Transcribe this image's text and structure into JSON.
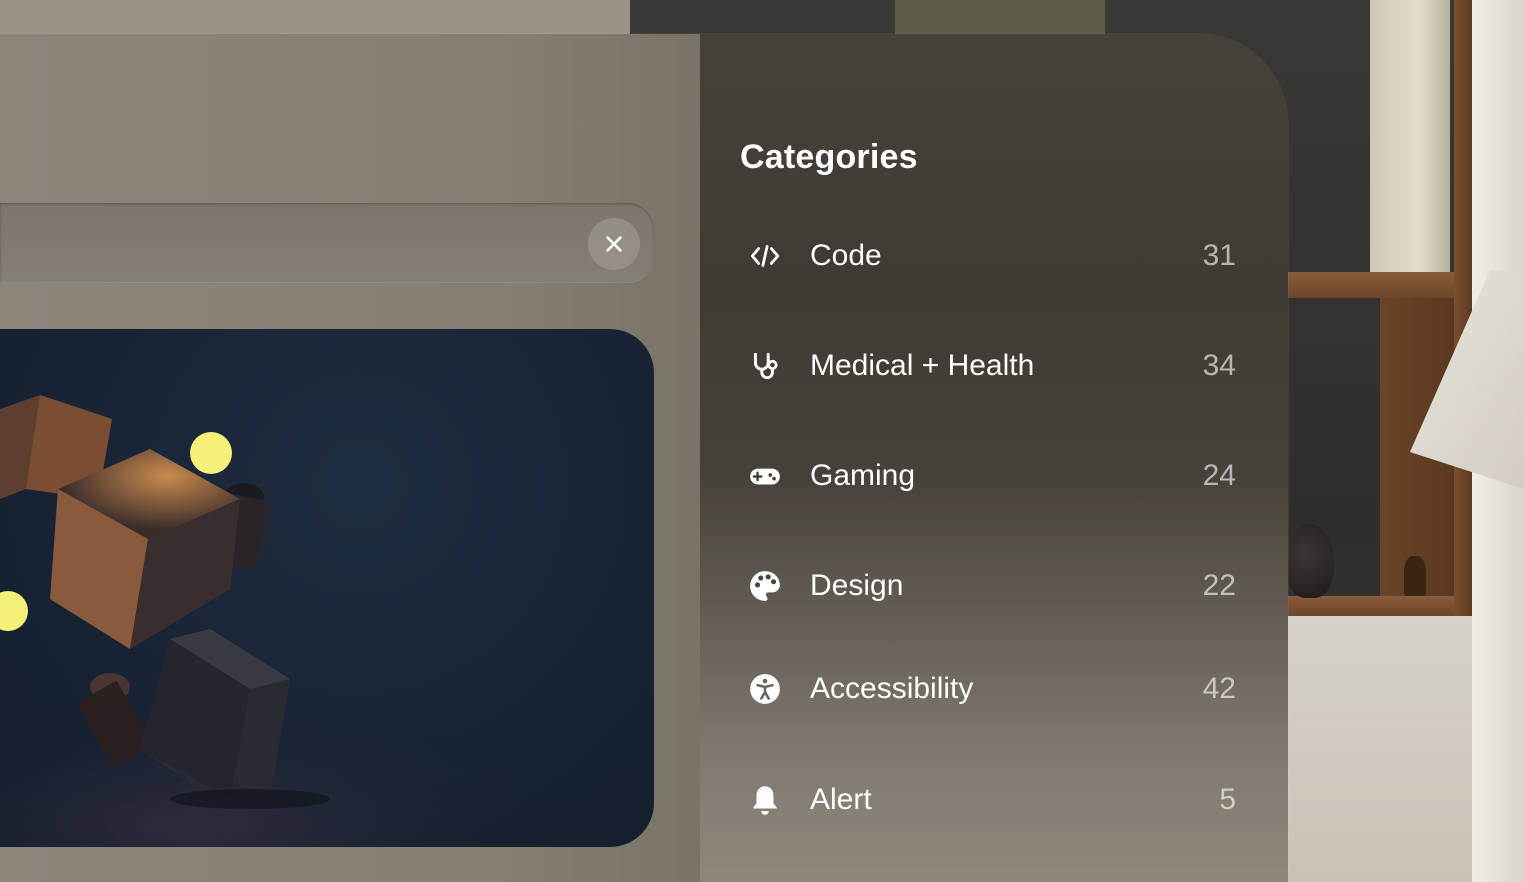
{
  "sidebar": {
    "title": "Categories",
    "items": [
      {
        "icon": "code-icon",
        "label": "Code",
        "count": "31"
      },
      {
        "icon": "stethoscope-icon",
        "label": "Medical + Health",
        "count": "34"
      },
      {
        "icon": "gamepad-icon",
        "label": "Gaming",
        "count": "24"
      },
      {
        "icon": "palette-icon",
        "label": "Design",
        "count": "22"
      },
      {
        "icon": "accessibility-icon",
        "label": "Accessibility",
        "count": "42"
      },
      {
        "icon": "bell-icon",
        "label": "Alert",
        "count": "5"
      }
    ]
  },
  "search": {
    "clear_icon": "close-icon"
  },
  "colors": {
    "text": "#ffffff",
    "count_text": "#c6c2bb",
    "sphere": "#f4f07a"
  }
}
